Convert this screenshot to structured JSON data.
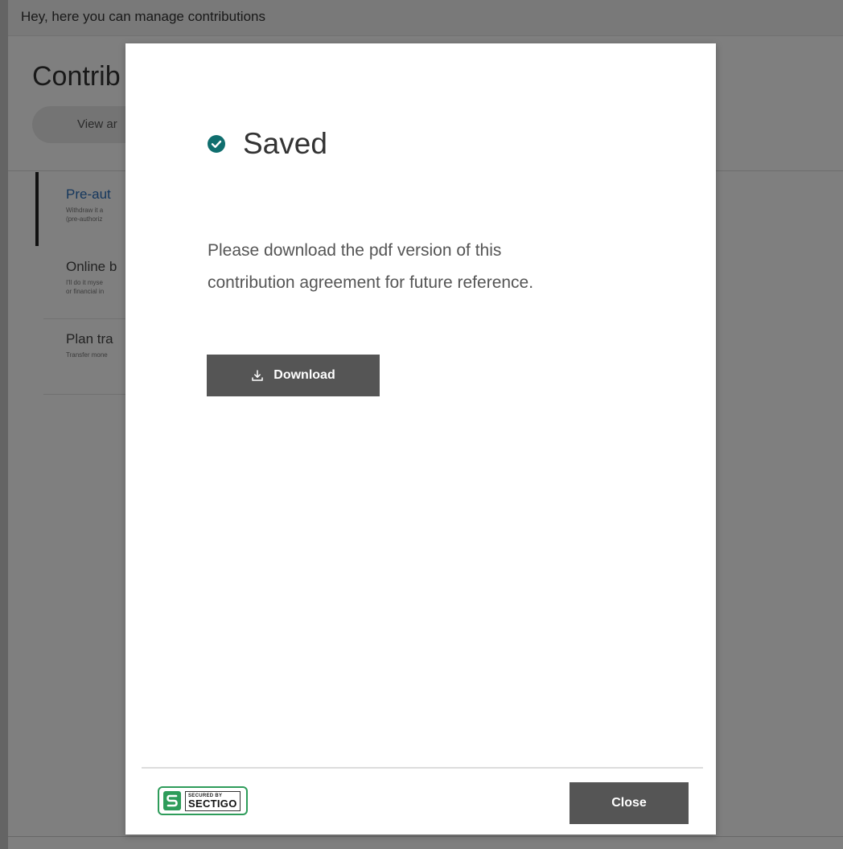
{
  "background": {
    "greeting": "Hey, here you can manage contributions",
    "title": "Contrib",
    "pill_label": "View ar",
    "options": [
      {
        "title": "Pre-aut",
        "desc_line1": "Withdraw it a",
        "desc_line2": "(pre-authoriz"
      },
      {
        "title": "Online b",
        "desc_line1": "I'll do it myse",
        "desc_line2": "or financial in"
      },
      {
        "title": "Plan tra",
        "desc_line1": "Transfer mone",
        "desc_line2": ""
      }
    ]
  },
  "modal": {
    "status_icon": "check-circle-icon",
    "status_title": "Saved",
    "message": "Please download the pdf version of this contribution agreement for future reference.",
    "download_label": "Download",
    "download_icon": "download-icon",
    "badge": {
      "small_text": "SECURED BY",
      "brand_text": "SECTIGO"
    },
    "close_label": "Close"
  },
  "colors": {
    "accent_teal": "#0f6e6e",
    "button_bg": "#555555",
    "badge_green": "#2e9c5a",
    "link_blue": "#2a6ebb"
  }
}
